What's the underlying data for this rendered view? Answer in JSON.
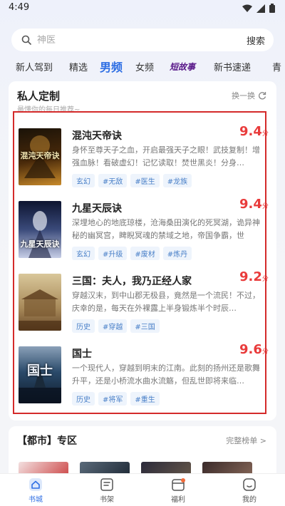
{
  "status_bar": {
    "time": "4:49"
  },
  "search": {
    "placeholder": "神医",
    "button": "搜索"
  },
  "tabs": [
    {
      "label": "新人驾到"
    },
    {
      "label": "精选"
    },
    {
      "label": "男频",
      "active": true
    },
    {
      "label": "女频"
    },
    {
      "label": "短故事"
    },
    {
      "label": "新书速递"
    },
    {
      "label": "青"
    }
  ],
  "section": {
    "title": "私人定制",
    "subtitle": "最懂你的每日推荐~",
    "refresh_label": "换一换"
  },
  "books": [
    {
      "title": "混沌天帝诀",
      "score": "9.4",
      "score_unit": "分",
      "description": "身怀至尊天子之血，开启最强天子之眼！武技复制！增强血脉！看破虚幻！记忆读取！焚世黑炎！分身…",
      "tags": [
        "玄幻",
        "#无敌",
        "#医生",
        "#龙族"
      ],
      "cover_text": "混沌天帝诀",
      "cover_colors": [
        "#1a1208",
        "#4a2a0a",
        "#c88a2a"
      ]
    },
    {
      "title": "九星天辰诀",
      "score": "9.4",
      "score_unit": "分",
      "description": "深埋地心的地底琼楼，沧海桑田演化的死冥湖，诡异神秘的幽冥宫，睥睨冥魂的禁域之地，帝国争霸，世",
      "tags": [
        "玄幻",
        "#升级",
        "#废材",
        "#炼丹"
      ],
      "cover_text": "九星天辰诀",
      "cover_colors": [
        "#0d1430",
        "#3a4a7a",
        "#c6cde6"
      ]
    },
    {
      "title": "三国：夫人，我乃正经人家",
      "score": "9.2",
      "score_unit": "分",
      "description": "穿越汉末，到中山郡无极县，竟然是一个流民！不过，庆幸的是，每天在外裸露上半身锻炼半个时辰…",
      "tags": [
        "历史",
        "#穿越",
        "#三国"
      ],
      "cover_text": "",
      "cover_colors": [
        "#a88a5a",
        "#d9c79a",
        "#6a4a2a"
      ]
    },
    {
      "title": "国士",
      "score": "9.6",
      "score_unit": "分",
      "description": "一个现代人，穿越到明末的江南。此刻的扬州还是歌舞升平，还是小桥流水曲水流觞，但乱世即将来临…",
      "tags": [
        "历史",
        "#将军",
        "#重生"
      ],
      "cover_text": "国士",
      "cover_colors": [
        "#0e1a2a",
        "#2a4a6a",
        "#8aa0b8"
      ]
    }
  ],
  "zone": {
    "title": "【都市】专区",
    "link": "完整榜单 >"
  },
  "bottom_nav": [
    {
      "label": "书城",
      "icon": "bookstore-icon",
      "active": true
    },
    {
      "label": "书架",
      "icon": "bookshelf-icon"
    },
    {
      "label": "福利",
      "icon": "gift-icon",
      "badge": true
    },
    {
      "label": "我的",
      "icon": "profile-icon"
    }
  ],
  "colors": {
    "accent": "#2f6fe4",
    "score": "#e93b3b",
    "highlight": "#d42a2a"
  }
}
